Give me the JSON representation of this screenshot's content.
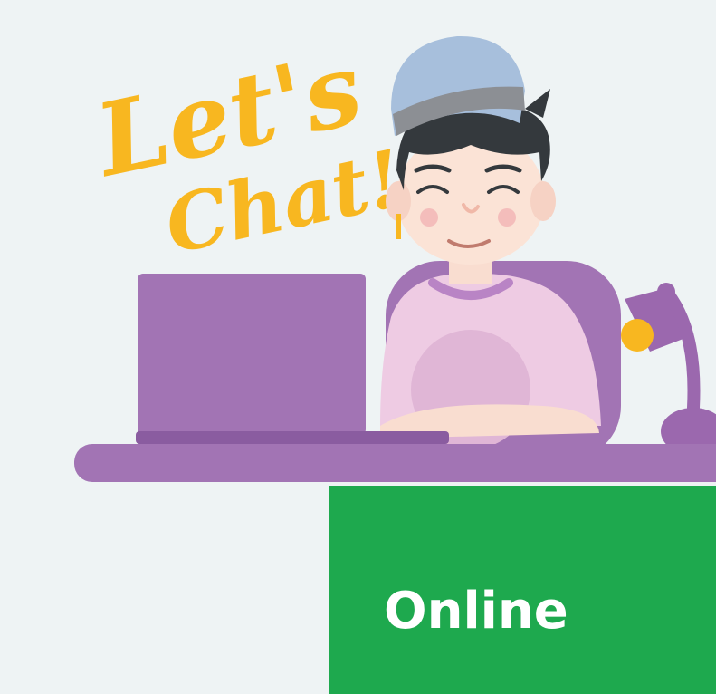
{
  "illustration": {
    "lettering": "Let's Chat!"
  },
  "status_panel": {
    "label": "Online",
    "color": "#1ea94e"
  },
  "colors": {
    "background": "#eef3f4",
    "accent_purple": "#a274b4",
    "lettering_yellow": "#f8b720"
  }
}
